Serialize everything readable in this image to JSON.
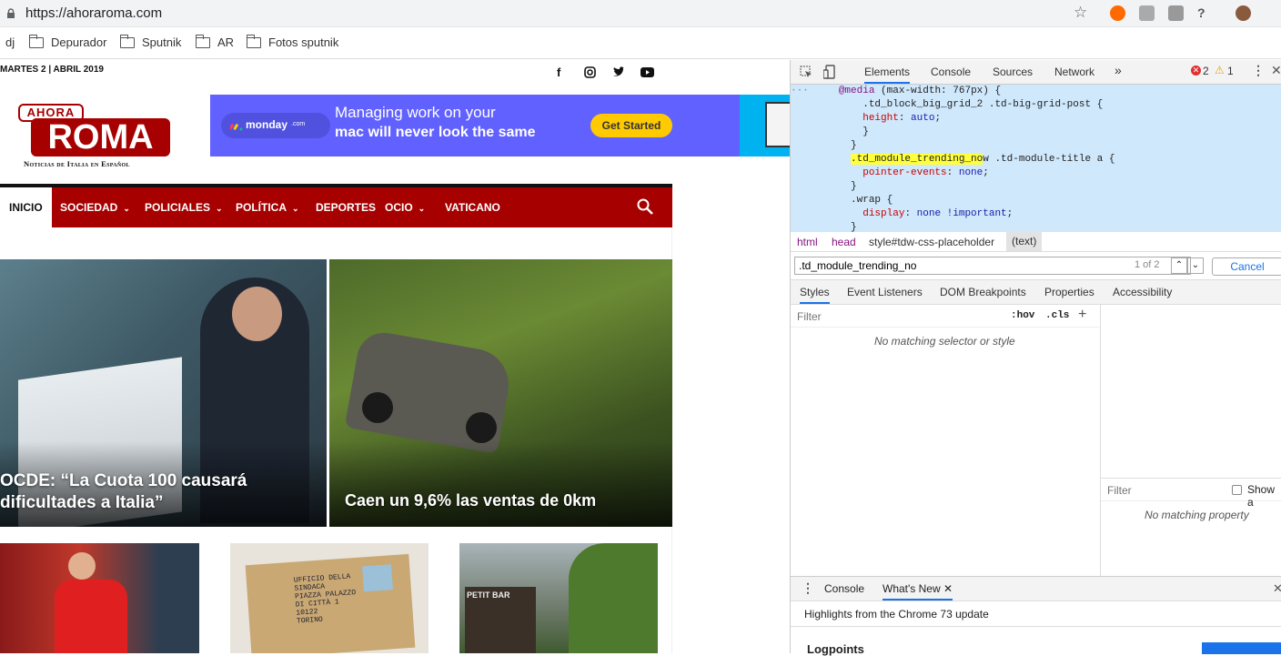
{
  "browser": {
    "url": "https://ahoraroma.com",
    "bookmarks": [
      "dj",
      "Depurador",
      "Sputnik",
      "AR",
      "Fotos sputnik"
    ]
  },
  "site": {
    "date": "MARTES 2 | ABRIL 2019",
    "logo_top": "AHORA",
    "logo_main": "ROMA",
    "logo_tagline": "Noticias de Italia en Español",
    "ad": {
      "brand": "monday",
      "brand_suffix": ".com",
      "line1": "Managing work on your",
      "line2": "mac will never look the same",
      "cta": "Get Started"
    },
    "nav": [
      {
        "label": "INICIO",
        "caret": false
      },
      {
        "label": "SOCIEDAD",
        "caret": true
      },
      {
        "label": "POLICIALES",
        "caret": true
      },
      {
        "label": "POLÍTICA",
        "caret": true
      },
      {
        "label": "DEPORTES",
        "caret": false
      },
      {
        "label": "OCIO",
        "caret": true
      },
      {
        "label": "VATICANO",
        "caret": false
      }
    ],
    "featured": [
      {
        "title_l1": "OCDE: “La Cuota 100 causará",
        "title_l2": "dificultades a Italia”"
      },
      {
        "title_l1": "Caen un 9,6% las ventas de 0km"
      }
    ],
    "package_text": [
      "UFFICIO DELLA",
      "SINDACA",
      "PIAZZA PALAZZO",
      "DI CITTÀ 1",
      "10122",
      "TORINO"
    ],
    "shop_sign": "PETIT BAR"
  },
  "devtools": {
    "tabs": [
      "Elements",
      "Console",
      "Sources",
      "Network"
    ],
    "more": "»",
    "errors": "2",
    "warnings": "1",
    "code": {
      "media": "@media",
      "media_q": "(max-width: 767px) {",
      "l2": "  .td_block_big_grid_2 .td-big-grid-post {",
      "l3_prop": "height",
      "l3_val": "auto",
      "close1": "  }",
      "close2": "}",
      "l6_hl": ".td_module_trending_no",
      "l6_rest": "w .td-module-title a {",
      "l7_prop": "pointer-events",
      "l7_val": "none",
      "close3": "}",
      "l9": ".wrap {",
      "l10_prop": "display",
      "l10_val": "none !important",
      "close4": "}"
    },
    "crumbs": [
      "html",
      "head",
      "style#tdw-css-placeholder",
      "(text)"
    ],
    "find_value": ".td_module_trending_no",
    "find_count": "1 of 2",
    "cancel": "Cancel",
    "style_tabs": [
      "Styles",
      "Event Listeners",
      "DOM Breakpoints",
      "Properties",
      "Accessibility"
    ],
    "filter_placeholder": "Filter",
    "hov": ":hov",
    "cls": ".cls",
    "no_style": "No matching selector or style",
    "filter2": "Filter",
    "show_all": "Show a",
    "no_prop": "No matching property",
    "drawer_tabs": [
      "Console",
      "What's New"
    ],
    "drawer_highlight": "Highlights from the Chrome 73 update",
    "drawer_item": "Logpoints"
  }
}
